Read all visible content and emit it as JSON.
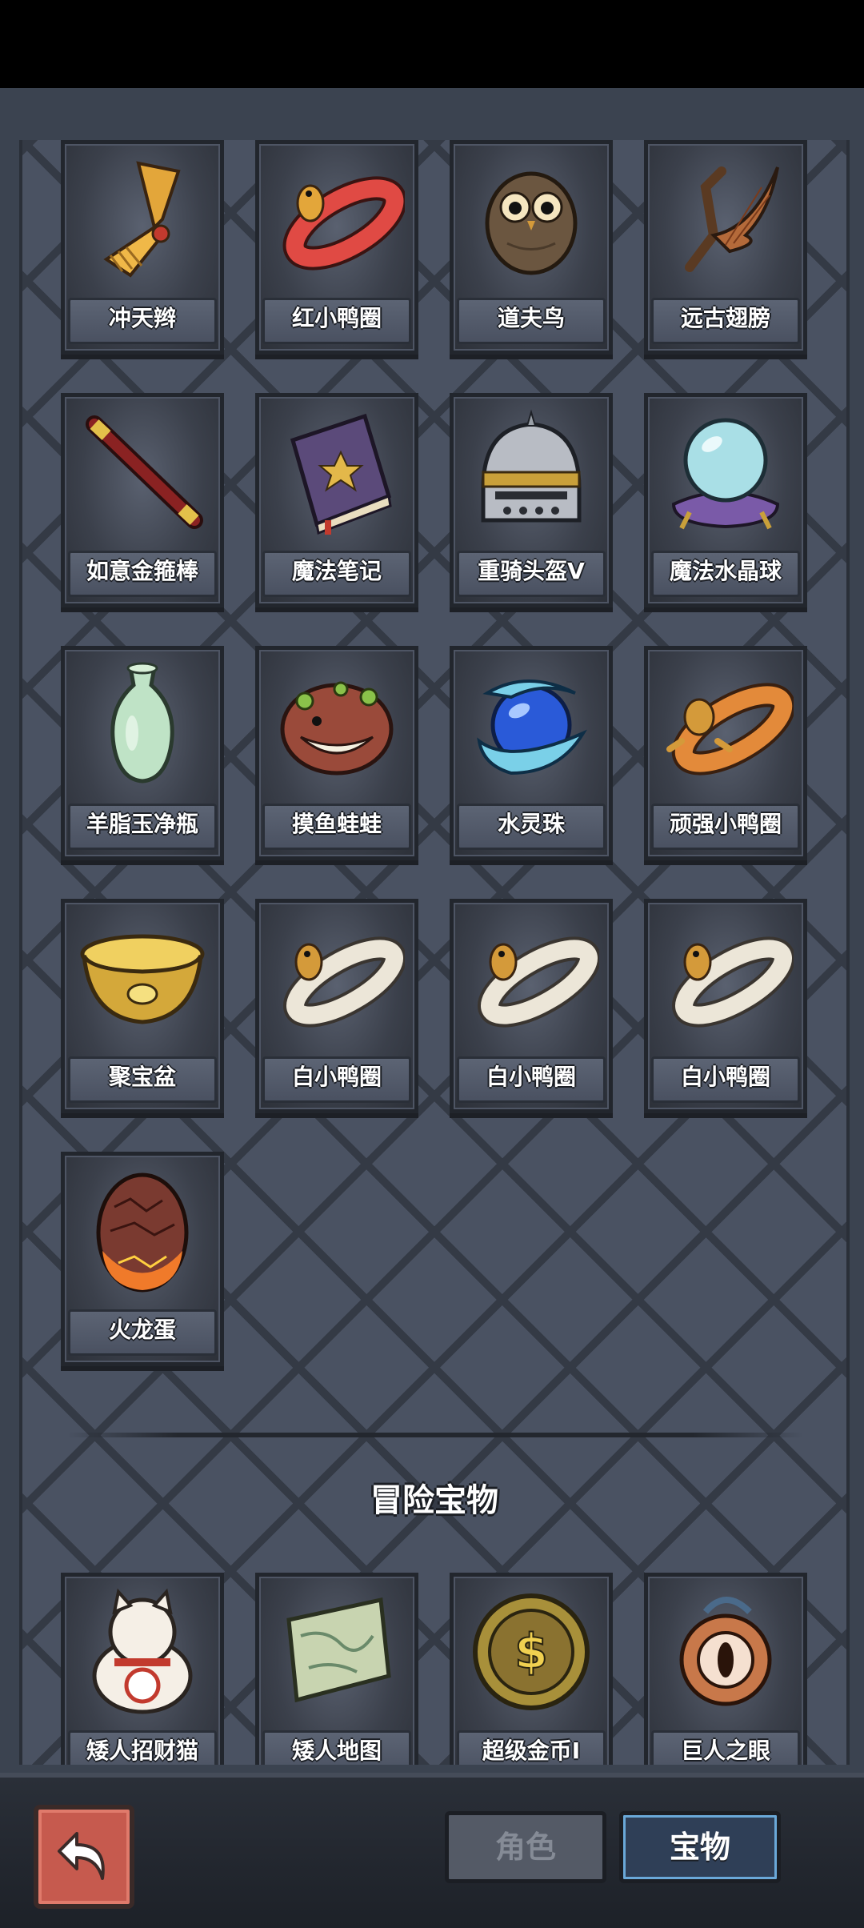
{
  "treasures": [
    {
      "name": "冲天辫",
      "icon": "golden-tassel-icon"
    },
    {
      "name": "红小鸭圈",
      "icon": "red-duck-ring-icon"
    },
    {
      "name": "道夫鸟",
      "icon": "owl-icon"
    },
    {
      "name": "远古翅膀",
      "icon": "ancient-wing-icon"
    },
    {
      "name": "如意金箍棒",
      "icon": "golden-staff-icon"
    },
    {
      "name": "魔法笔记",
      "icon": "magic-book-icon"
    },
    {
      "name": "重骑头盔V",
      "icon": "knight-helmet-icon"
    },
    {
      "name": "魔法水晶球",
      "icon": "crystal-ball-icon"
    },
    {
      "name": "羊脂玉净瓶",
      "icon": "jade-vase-icon"
    },
    {
      "name": "摸鱼蛙蛙",
      "icon": "frog-icon"
    },
    {
      "name": "水灵珠",
      "icon": "water-orb-icon"
    },
    {
      "name": "顽强小鸭圈",
      "icon": "orange-duck-ring-icon"
    },
    {
      "name": "聚宝盆",
      "icon": "treasure-bowl-icon"
    },
    {
      "name": "白小鸭圈",
      "icon": "white-duck-ring-icon"
    },
    {
      "name": "白小鸭圈",
      "icon": "white-duck-ring-icon"
    },
    {
      "name": "白小鸭圈",
      "icon": "white-duck-ring-icon"
    },
    {
      "name": "火龙蛋",
      "icon": "fire-dragon-egg-icon"
    }
  ],
  "adventure_section": {
    "title": "冒险宝物",
    "items": [
      {
        "name": "矮人招财猫",
        "icon": "lucky-cat-icon"
      },
      {
        "name": "矮人地图",
        "icon": "map-scroll-icon"
      },
      {
        "name": "超级金币I",
        "icon": "gold-coin-icon"
      },
      {
        "name": "巨人之眼",
        "icon": "giant-eye-icon"
      }
    ]
  },
  "bottom_bar": {
    "back_icon": "back-arrow-icon",
    "tabs": [
      {
        "label": "角色",
        "active": false
      },
      {
        "label": "宝物",
        "active": true
      }
    ]
  },
  "colors": {
    "panel": "#4a5262",
    "tab_active": "#2f3f57",
    "back_button": "#c65a4e"
  }
}
